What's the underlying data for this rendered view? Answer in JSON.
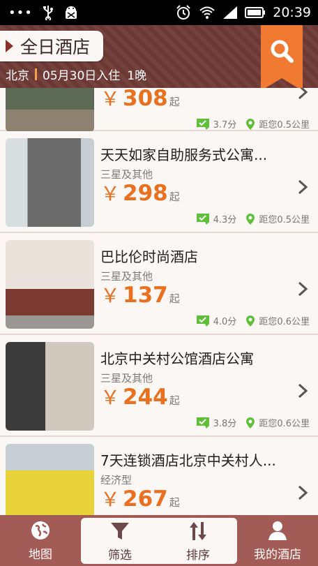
{
  "status_bar": {
    "time": "20:39"
  },
  "header": {
    "title": "全日酒店",
    "city": "北京",
    "checkin": "05月30日入住",
    "nights": "1晚"
  },
  "hotels": [
    {
      "name": "",
      "star": "",
      "price": "308",
      "price_suffix": "起",
      "score": "3.7分",
      "distance": "距您0.5公里"
    },
    {
      "name": "天天如家自助服务式公寓...",
      "star": "三星及其他",
      "price": "298",
      "price_suffix": "起",
      "score": "4.3分",
      "distance": "距您0.5公里"
    },
    {
      "name": "巴比伦时尚酒店",
      "star": "三星及其他",
      "price": "137",
      "price_suffix": "起",
      "score": "4.0分",
      "distance": "距您0.6公里"
    },
    {
      "name": "北京中关村公馆酒店公寓",
      "star": "三星及其他",
      "price": "244",
      "price_suffix": "起",
      "score": "3.8分",
      "distance": "距您0.6公里"
    },
    {
      "name": "7天连锁酒店北京中关村人...",
      "star": "经济型",
      "price": "267",
      "price_suffix": "起",
      "score": "",
      "distance": ""
    }
  ],
  "currency_symbol": "￥",
  "bottom_nav": {
    "map": "地图",
    "filter": "筛选",
    "sort": "排序",
    "my_hotels": "我的酒店"
  },
  "colors": {
    "header": "#6f3a36",
    "accent": "#e8701f",
    "ribbon": "#f07a32",
    "nav": "#a35b56",
    "badge_green": "#5fbf3b"
  }
}
